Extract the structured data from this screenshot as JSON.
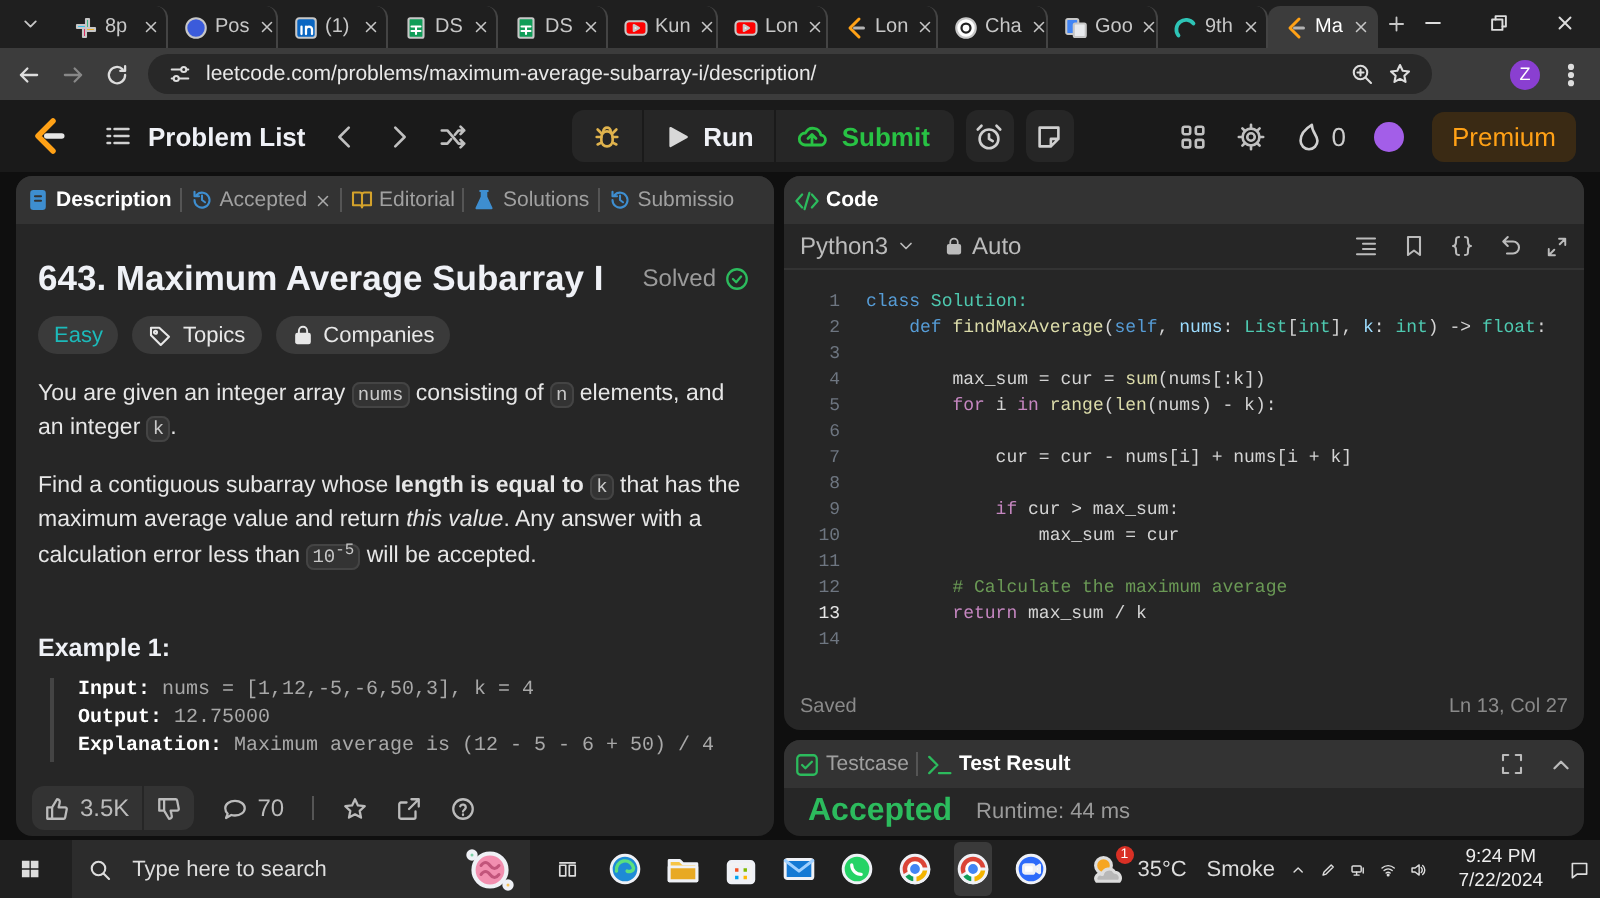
{
  "browser": {
    "tabs": [
      {
        "label": "8p",
        "kind": "slack",
        "selected": false
      },
      {
        "label": "Pos",
        "kind": "badge",
        "selected": false
      },
      {
        "label": "(1)",
        "kind": "linkedin",
        "selected": false
      },
      {
        "label": "DS",
        "kind": "sheets",
        "selected": false
      },
      {
        "label": "DS",
        "kind": "sheets",
        "selected": false
      },
      {
        "label": "Kun",
        "kind": "video",
        "selected": false
      },
      {
        "label": "Lon",
        "kind": "video",
        "selected": false
      },
      {
        "label": "Lon",
        "kind": "leetcode",
        "selected": false
      },
      {
        "label": "Cha",
        "kind": "knot",
        "selected": false
      },
      {
        "label": "Goo",
        "kind": "translate",
        "selected": false
      },
      {
        "label": "9th",
        "kind": "arc",
        "selected": false
      },
      {
        "label": "Ma",
        "kind": "leetcode",
        "selected": true
      }
    ],
    "url": "leetcode.com/problems/maximum-average-subarray-i/description/",
    "profile": "Z"
  },
  "header": {
    "problem_list": "Problem List",
    "run": "Run",
    "submit": "Submit",
    "streak": "0",
    "premium": "Premium"
  },
  "description_panel": {
    "tabs": [
      {
        "label": "Description",
        "kind": "doc",
        "selected": true,
        "closable": false
      },
      {
        "label": "Accepted",
        "kind": "history",
        "selected": false,
        "closable": true
      },
      {
        "label": "Editorial",
        "kind": "book",
        "selected": false,
        "closable": false
      },
      {
        "label": "Solutions",
        "kind": "flask",
        "selected": false,
        "closable": false
      },
      {
        "label": "Submissio",
        "kind": "history",
        "selected": false,
        "closable": false
      }
    ],
    "title": "643. Maximum Average Subarray I",
    "status": "Solved",
    "tags": [
      {
        "label": "Easy",
        "kind": "difficulty"
      },
      {
        "label": "Topics",
        "kind": "topics"
      },
      {
        "label": "Companies",
        "kind": "companies"
      }
    ],
    "paragraphs": [
      [
        {
          "kind": "text",
          "text": "You are given an integer array "
        },
        {
          "kind": "code",
          "text": "nums"
        },
        {
          "kind": "text",
          "text": " consisting of "
        },
        {
          "kind": "code",
          "text": "n"
        },
        {
          "kind": "text",
          "text": " elements, and an integer "
        },
        {
          "kind": "code",
          "text": "k"
        },
        {
          "kind": "text",
          "text": "."
        }
      ],
      [
        {
          "kind": "text",
          "text": "Find a contiguous subarray whose **length is equal to** "
        },
        {
          "kind": "code",
          "text": "k"
        },
        {
          "kind": "text",
          "text": " that has the maximum average value and return *this value*. Any answer with a calculation error less than "
        },
        {
          "kind": "code",
          "text": "10$^{-5}$"
        },
        {
          "kind": "text",
          "text": " will be accepted."
        }
      ]
    ],
    "example_title": "Example 1:",
    "example_lines": [
      "**Input:** nums = [1,12,-5,-6,50,3], k = 4",
      "**Output:** 12.75000",
      "**Explanation:** Maximum average is (12 - 5 - 6 + 50) / 4"
    ],
    "footer": {
      "likes": "3.5K",
      "comments": "70"
    }
  },
  "code_panel": {
    "title": "Code",
    "language": "Python3",
    "mode": "Auto",
    "lines": [
      {
        "number": "1",
        "current": false,
        "tokens": [
          {
            "text": "class",
            "kind": "keyword"
          },
          {
            "text": " Solution:",
            "kind": "type"
          }
        ]
      },
      {
        "number": "2",
        "current": false,
        "tokens": [
          {
            "text": "    def",
            "kind": "keyword"
          },
          {
            "text": " findMaxAverage",
            "kind": "function"
          },
          {
            "text": "(",
            "kind": "plain"
          },
          {
            "text": "self",
            "kind": "keyword"
          },
          {
            "text": ", ",
            "kind": "plain"
          },
          {
            "text": "nums",
            "kind": "variable"
          },
          {
            "text": ": ",
            "kind": "plain"
          },
          {
            "text": "List",
            "kind": "type"
          },
          {
            "text": "[",
            "kind": "plain"
          },
          {
            "text": "int",
            "kind": "type"
          },
          {
            "text": "], ",
            "kind": "plain"
          },
          {
            "text": "k",
            "kind": "variable"
          },
          {
            "text": ": ",
            "kind": "plain"
          },
          {
            "text": "int",
            "kind": "type"
          },
          {
            "text": ") -> ",
            "kind": "plain"
          },
          {
            "text": "float",
            "kind": "type"
          },
          {
            "text": ":",
            "kind": "plain"
          }
        ]
      },
      {
        "number": "3",
        "current": false
      },
      {
        "number": "4",
        "current": false,
        "tokens": [
          {
            "text": "        max_sum = cur = ",
            "kind": "plain"
          },
          {
            "text": "sum",
            "kind": "function"
          },
          {
            "text": "(nums[:k])",
            "kind": "plain"
          }
        ]
      },
      {
        "number": "5",
        "current": false,
        "tokens": [
          {
            "text": "        for",
            "kind": "control"
          },
          {
            "text": " i ",
            "kind": "plain"
          },
          {
            "text": "in",
            "kind": "control"
          },
          {
            "text": " range",
            "kind": "function"
          },
          {
            "text": "(",
            "kind": "plain"
          },
          {
            "text": "len",
            "kind": "function"
          },
          {
            "text": "(nums) - k):",
            "kind": "plain"
          }
        ]
      },
      {
        "number": "6",
        "current": false
      },
      {
        "number": "7",
        "current": false,
        "tokens": [
          {
            "text": "            cur = cur - nums[i] + nums[i + k]",
            "kind": "plain"
          }
        ]
      },
      {
        "number": "8",
        "current": false
      },
      {
        "number": "9",
        "current": false,
        "tokens": [
          {
            "text": "            if",
            "kind": "control"
          },
          {
            "text": " cur > max_sum:",
            "kind": "plain"
          }
        ]
      },
      {
        "number": "10",
        "current": false,
        "tokens": [
          {
            "text": "                max_sum = cur",
            "kind": "plain"
          }
        ]
      },
      {
        "number": "11",
        "current": false
      },
      {
        "number": "12",
        "current": false,
        "tokens": [
          {
            "text": "        # Calculate the maximum average",
            "kind": "comment"
          }
        ]
      },
      {
        "number": "13",
        "current": true,
        "tokens": [
          {
            "text": "        return",
            "kind": "control"
          },
          {
            "text": " max_sum / k",
            "kind": "plain"
          }
        ]
      },
      {
        "number": "14",
        "current": false
      }
    ],
    "status": "Saved",
    "cursor": "Ln 13, Col 27"
  },
  "result_panel": {
    "tabs": [
      {
        "label": "Testcase",
        "kind": "check-square",
        "selected": false
      },
      {
        "label": "Test Result",
        "kind": "terminal",
        "selected": true
      }
    ],
    "verdict": "Accepted",
    "runtime": "Runtime: 44 ms"
  },
  "taskbar": {
    "search_placeholder": "Type here to search",
    "apps": [
      {
        "kind": "edge",
        "selected": false
      },
      {
        "kind": "folder",
        "selected": false
      },
      {
        "kind": "store",
        "selected": false
      },
      {
        "kind": "mail",
        "selected": false
      },
      {
        "kind": "chat",
        "selected": false
      },
      {
        "kind": "chrome",
        "selected": false
      },
      {
        "kind": "chrome",
        "selected": true
      },
      {
        "kind": "video-call",
        "selected": false
      }
    ],
    "weather_badge": "1",
    "temperature": "35°C",
    "condition": "Smoke",
    "time": "9:24 PM",
    "date": "7/22/2024"
  }
}
